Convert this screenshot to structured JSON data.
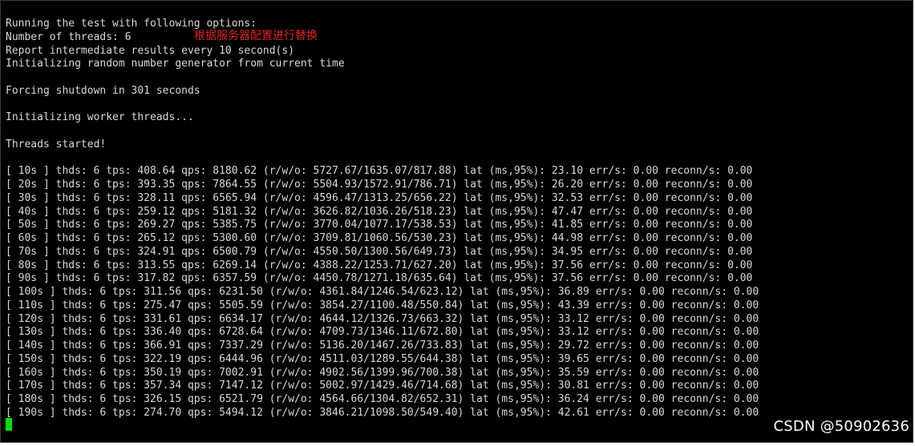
{
  "terminal": {
    "lines": [
      "Running the test with following options:",
      "Number of threads: 6",
      "Report intermediate results every 10 second(s)",
      "Initializing random number generator from current time",
      "",
      "Forcing shutdown in 301 seconds",
      "",
      "Initializing worker threads...",
      "",
      "Threads started!",
      "",
      "[ 10s ] thds: 6 tps: 408.64 qps: 8180.62 (r/w/o: 5727.67/1635.07/817.88) lat (ms,95%): 23.10 err/s: 0.00 reconn/s: 0.00",
      "[ 20s ] thds: 6 tps: 393.35 qps: 7864.55 (r/w/o: 5504.93/1572.91/786.71) lat (ms,95%): 26.20 err/s: 0.00 reconn/s: 0.00",
      "[ 30s ] thds: 6 tps: 328.11 qps: 6565.94 (r/w/o: 4596.47/1313.25/656.22) lat (ms,95%): 32.53 err/s: 0.00 reconn/s: 0.00",
      "[ 40s ] thds: 6 tps: 259.12 qps: 5181.32 (r/w/o: 3626.82/1036.26/518.23) lat (ms,95%): 47.47 err/s: 0.00 reconn/s: 0.00",
      "[ 50s ] thds: 6 tps: 269.27 qps: 5385.75 (r/w/o: 3770.04/1077.17/538.53) lat (ms,95%): 41.85 err/s: 0.00 reconn/s: 0.00",
      "[ 60s ] thds: 6 tps: 265.12 qps: 5300.60 (r/w/o: 3709.81/1060.56/530.23) lat (ms,95%): 44.98 err/s: 0.00 reconn/s: 0.00",
      "[ 70s ] thds: 6 tps: 324.91 qps: 6500.79 (r/w/o: 4550.50/1300.56/649.73) lat (ms,95%): 34.95 err/s: 0.00 reconn/s: 0.00",
      "[ 80s ] thds: 6 tps: 313.55 qps: 6269.14 (r/w/o: 4388.22/1253.71/627.20) lat (ms,95%): 37.56 err/s: 0.00 reconn/s: 0.00",
      "[ 90s ] thds: 6 tps: 317.82 qps: 6357.59 (r/w/o: 4450.78/1271.18/635.64) lat (ms,95%): 37.56 err/s: 0.00 reconn/s: 0.00",
      "[ 100s ] thds: 6 tps: 311.56 qps: 6231.50 (r/w/o: 4361.84/1246.54/623.12) lat (ms,95%): 36.89 err/s: 0.00 reconn/s: 0.00",
      "[ 110s ] thds: 6 tps: 275.47 qps: 5505.59 (r/w/o: 3854.27/1100.48/550.84) lat (ms,95%): 43.39 err/s: 0.00 reconn/s: 0.00",
      "[ 120s ] thds: 6 tps: 331.61 qps: 6634.17 (r/w/o: 4644.12/1326.73/663.32) lat (ms,95%): 33.12 err/s: 0.00 reconn/s: 0.00",
      "[ 130s ] thds: 6 tps: 336.40 qps: 6728.64 (r/w/o: 4709.73/1346.11/672.80) lat (ms,95%): 33.12 err/s: 0.00 reconn/s: 0.00",
      "[ 140s ] thds: 6 tps: 366.91 qps: 7337.29 (r/w/o: 5136.20/1467.26/733.83) lat (ms,95%): 29.72 err/s: 0.00 reconn/s: 0.00",
      "[ 150s ] thds: 6 tps: 322.19 qps: 6444.96 (r/w/o: 4511.03/1289.55/644.38) lat (ms,95%): 39.65 err/s: 0.00 reconn/s: 0.00",
      "[ 160s ] thds: 6 tps: 350.19 qps: 7002.91 (r/w/o: 4902.56/1399.96/700.38) lat (ms,95%): 35.59 err/s: 0.00 reconn/s: 0.00",
      "[ 170s ] thds: 6 tps: 357.34 qps: 7147.12 (r/w/o: 5002.97/1429.46/714.68) lat (ms,95%): 30.81 err/s: 0.00 reconn/s: 0.00",
      "[ 180s ] thds: 6 tps: 326.15 qps: 6521.79 (r/w/o: 4564.66/1304.82/652.31) lat (ms,95%): 36.24 err/s: 0.00 reconn/s: 0.00",
      "[ 190s ] thds: 6 tps: 274.70 qps: 5494.12 (r/w/o: 3846.21/1098.50/549.40) lat (ms,95%): 42.61 err/s: 0.00 reconn/s: 0.00"
    ],
    "annotation": "根据服务器配置进行替换",
    "cursor_color": "#00e000",
    "background": "#000000",
    "text_color": "#d8d8d8",
    "annotation_color": "#e0251f"
  },
  "watermark": {
    "text": "CSDN @50902636"
  }
}
